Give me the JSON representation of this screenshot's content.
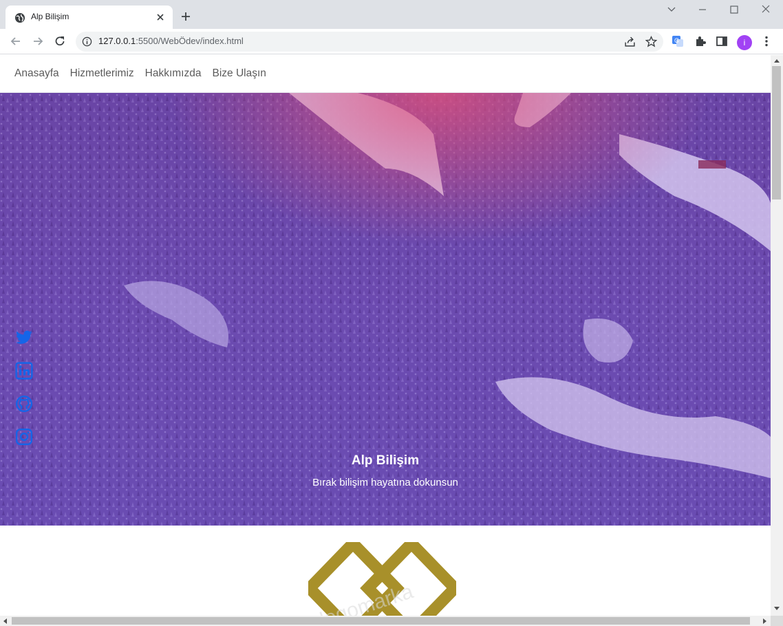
{
  "browser": {
    "tab_title": "Alp Bilişim",
    "url_host": "127.0.0.1",
    "url_rest": ":5500/WebÖdev/index.html",
    "profile_initial": "i"
  },
  "nav": {
    "items": [
      "Anasayfa",
      "Hizmetlerimiz",
      "Hakkımızda",
      "Bize Ulaşın"
    ]
  },
  "hero": {
    "title": "Alp Bilişim",
    "subtitle": "Bırak bilişim hayatına dokunsun"
  },
  "social": [
    "twitter-icon",
    "linkedin-icon",
    "github-icon",
    "instagram-icon"
  ],
  "colors": {
    "accent_blue": "#1565e8",
    "logo_gold": "#a8902a",
    "hero_overlay": "#7a4fc0"
  }
}
